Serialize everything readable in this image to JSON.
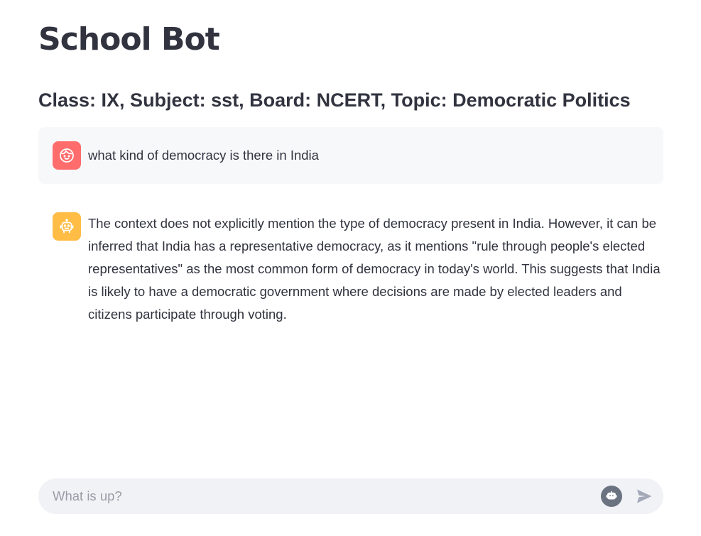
{
  "header": {
    "title": "School Bot",
    "subtitle": "Class: IX, Subject: sst, Board: NCERT, Topic: Democratic Politics"
  },
  "messages": [
    {
      "role": "user",
      "avatar_icon": "user-face-icon",
      "avatar_color": "#ff6c6c",
      "text": "what kind of democracy is there in India"
    },
    {
      "role": "assistant",
      "avatar_icon": "bot-icon",
      "avatar_color": "#ffbd45",
      "text": "The context does not explicitly mention the type of democracy present in India. However, it can be inferred that India has a representative democracy, as it mentions \"rule through people's elected representatives\" as the most common form of democracy in today's world. This suggests that India is likely to have a democratic government where decisions are made by elected leaders and citizens participate through voting."
    }
  ],
  "chat_input": {
    "placeholder": "What is up?",
    "value": ""
  },
  "icons": {
    "input_bot": "bot-icon",
    "send": "send-icon"
  },
  "colors": {
    "text": "#31333f",
    "user_bubble_bg": "#f7f8fa",
    "input_bg": "#f0f2f6"
  }
}
